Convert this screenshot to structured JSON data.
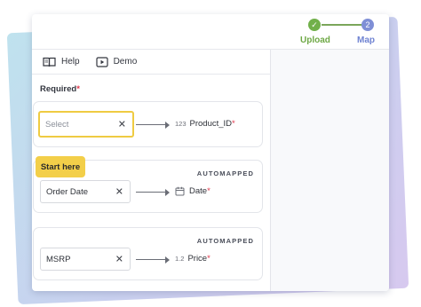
{
  "stepper": {
    "steps": [
      {
        "label": "Upload",
        "marker": "✓",
        "state": "done"
      },
      {
        "label": "Map",
        "marker": "2",
        "state": "current"
      }
    ]
  },
  "toolbar": {
    "help_label": "Help",
    "help_icon": "book-icon",
    "demo_label": "Demo",
    "demo_icon": "play-icon"
  },
  "required_label": "Required",
  "required_marker": "*",
  "mappings": [
    {
      "select_value": "",
      "select_placeholder": "Select",
      "target": "Product_ID",
      "type_label": "123",
      "required_mark": "*",
      "status": ""
    },
    {
      "select_value": "Order Date",
      "target": "Date",
      "type_label": "calendar-icon",
      "required_mark": "*",
      "status": "AUTOMAPPED"
    },
    {
      "select_value": "MSRP",
      "target": "Price",
      "type_label": "1.2",
      "required_mark": "*",
      "status": "AUTOMAPPED"
    }
  ],
  "start_here_label": "Start here",
  "clear_glyph": "✕",
  "colors": {
    "accent_yellow": "#f3cf49",
    "done_green": "#71b04a",
    "current_blue": "#7f8fd6",
    "required_red": "#e0374b"
  }
}
